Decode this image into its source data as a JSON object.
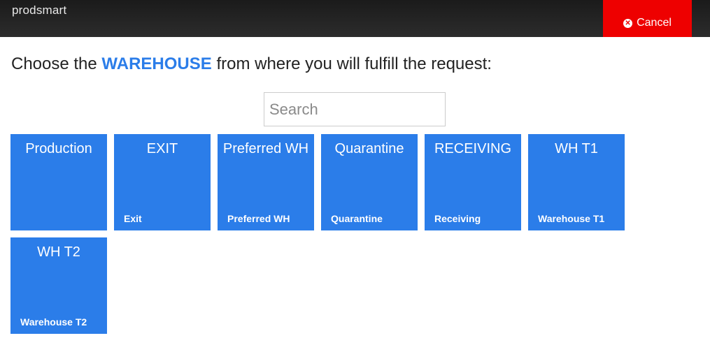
{
  "header": {
    "logo": "prodsmart",
    "cancel_label": "Cancel",
    "cancel_icon": "times-circle-icon",
    "cancel_color": "#ee0000"
  },
  "prompt": {
    "before": "Choose the ",
    "highlight": "WAREHOUSE",
    "after": " from where you will fulfill the request:",
    "highlight_color": "#2b7de9"
  },
  "search": {
    "placeholder": "Search",
    "value": ""
  },
  "tile_color": "#2b7de9",
  "warehouses": [
    {
      "title": "Production",
      "subtitle": ""
    },
    {
      "title": "EXIT",
      "subtitle": "Exit"
    },
    {
      "title": "Preferred WH",
      "subtitle": "Preferred WH"
    },
    {
      "title": "Quarantine",
      "subtitle": "Quarantine"
    },
    {
      "title": "RECEIVING",
      "subtitle": "Receiving"
    },
    {
      "title": "WH T1",
      "subtitle": "Warehouse T1"
    },
    {
      "title": "WH T2",
      "subtitle": "Warehouse T2"
    }
  ]
}
